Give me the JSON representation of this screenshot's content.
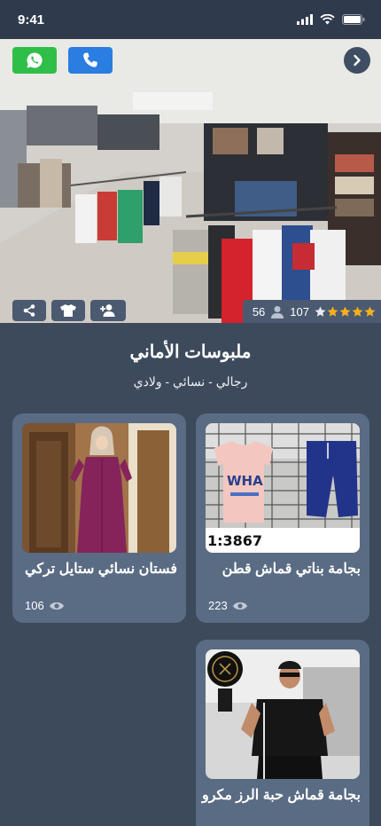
{
  "status_bar": {
    "time": "9:41"
  },
  "hero": {
    "rating_stars": 4,
    "rating_count": "107",
    "followers": "56"
  },
  "store": {
    "name": "ملبوسات الأماني",
    "categories": "رجالي - نسائي - ولادي"
  },
  "products": [
    {
      "title": "بجامة بناتي قماش قطن",
      "views": "223",
      "image_text": "WHA",
      "image_code": "1:3867"
    },
    {
      "title": "فستان نسائي ستايل تركي",
      "views": "106"
    },
    {
      "title": "بجامة قماش حبة الرز مكرو",
      "views": ""
    }
  ],
  "colors": {
    "background": "#3d4a5c",
    "card": "#5a6b84",
    "whatsapp": "#2fbf48",
    "phone": "#2a7de1",
    "star": "#f5b01e"
  },
  "icons": [
    "whatsapp-icon",
    "phone-icon",
    "chevron-right-icon",
    "share-icon",
    "shirt-icon",
    "add-user-icon",
    "star-icon",
    "user-icon",
    "eye-icon"
  ]
}
